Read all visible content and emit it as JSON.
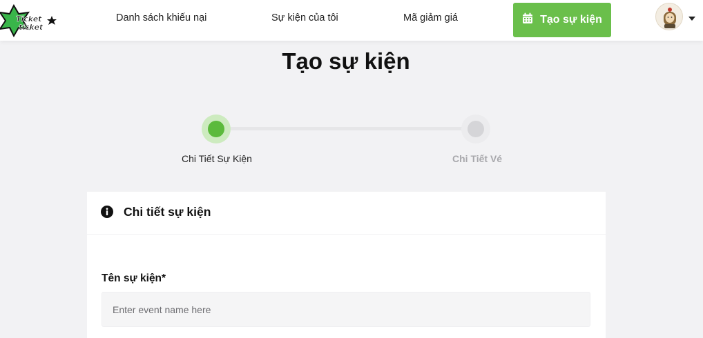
{
  "header": {
    "logo_text": "Ticket ticket",
    "nav": [
      {
        "label": "Danh sách khiếu nại"
      },
      {
        "label": "Sự kiện của tôi"
      },
      {
        "label": "Mã giảm giá"
      }
    ],
    "create_button_label": "Tạo sự kiện",
    "accent_color": "#6abf4b"
  },
  "page": {
    "title": "Tạo sự kiện"
  },
  "stepper": {
    "steps": [
      {
        "label": "Chi Tiết Sự Kiện",
        "state": "active"
      },
      {
        "label": "Chi Tiết Vé",
        "state": "pending"
      }
    ]
  },
  "form": {
    "section_title": "Chi tiết sự kiện",
    "section_icon": "info-icon",
    "fields": [
      {
        "label": "Tên sự kiện*",
        "placeholder": "Enter event name here",
        "value": ""
      }
    ]
  }
}
